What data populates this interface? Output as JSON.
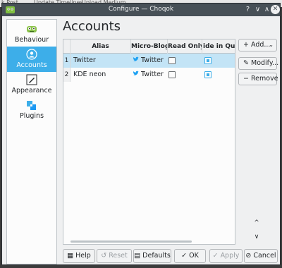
{
  "background": {
    "items": [
      "k Post",
      "Update Timelines",
      "Upload Medium"
    ]
  },
  "window": {
    "title": "Configure — Choqok",
    "help_glyph": "?",
    "minimize_glyph": "∨",
    "maximize_glyph": "∧",
    "close_glyph": "✕"
  },
  "sidebar": {
    "items": [
      {
        "label": "Behaviour",
        "icon": "behaviour-icon",
        "active": false
      },
      {
        "label": "Accounts",
        "icon": "accounts-icon",
        "active": true
      },
      {
        "label": "Appearance",
        "icon": "appearance-icon",
        "active": false
      },
      {
        "label": "Plugins",
        "icon": "plugins-icon",
        "active": false
      }
    ]
  },
  "page": {
    "title": "Accounts"
  },
  "table": {
    "columns": [
      "Alias",
      "Micro-Blog",
      "Read Only",
      "ide in Quick"
    ],
    "rows": [
      {
        "num": "1",
        "alias": "Twitter",
        "blog": "Twitter",
        "read_only": false,
        "quick": true,
        "selected": true
      },
      {
        "num": "2",
        "alias": "KDE neon",
        "blog": "Twitter",
        "read_only": false,
        "quick": true,
        "selected": false
      }
    ]
  },
  "side_buttons": {
    "add": "Add...",
    "modify": "Modify...",
    "remove": "Remove",
    "up_glyph": "^",
    "down_glyph": "∨"
  },
  "footer": {
    "help": "Help",
    "reset": "Reset",
    "defaults": "Defaults",
    "ok": "OK",
    "apply": "Apply",
    "cancel": "Cancel"
  },
  "colors": {
    "accent": "#3daee9",
    "titlebar": "#475057",
    "selection": "#c3e4f6",
    "twitter": "#1da1f2"
  }
}
